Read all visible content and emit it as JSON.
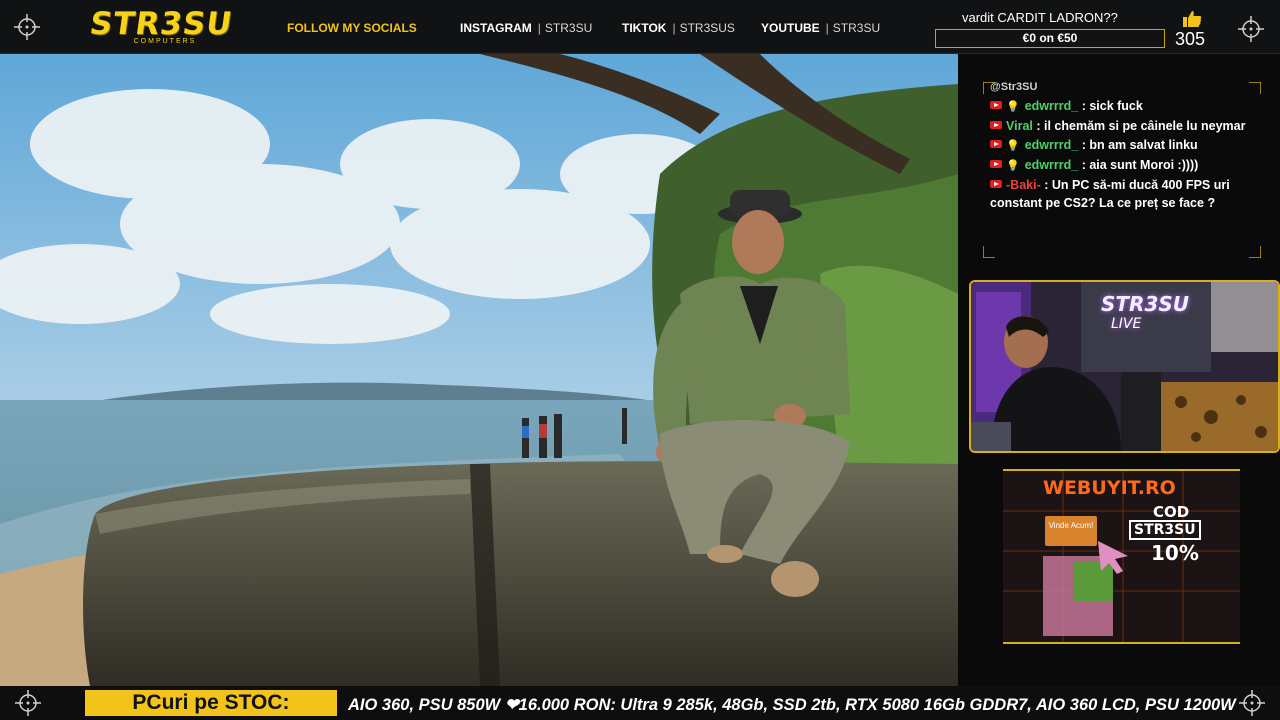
{
  "header": {
    "logo_text": "STR3SU",
    "logo_sub": "COMPUTERS",
    "follow_label": "FOLLOW MY SOCIALS",
    "socials": [
      {
        "platform": "INSTAGRAM",
        "handle": "STR3SU"
      },
      {
        "platform": "TIKTOK",
        "handle": "STR3SUS"
      },
      {
        "platform": "YOUTUBE",
        "handle": "STR3SU"
      }
    ],
    "separator": "|"
  },
  "poll": {
    "title": "vardit CARDIT LADRON??",
    "amount": "€0 on €50"
  },
  "likes": {
    "icon": "thumbs-up-icon",
    "count": "305"
  },
  "chat": {
    "prev_line": "@Str3SU",
    "messages": [
      {
        "user": "edwrrrd_",
        "user_color": "green",
        "badge": "bulb",
        "text": ": sick fuck"
      },
      {
        "user": "Viral",
        "user_color": "green",
        "badge": "",
        "text": ": il chemăm si pe câinele lu neymar"
      },
      {
        "user": "edwrrrd_",
        "user_color": "green",
        "badge": "bulb",
        "text": ": bn am salvat linku"
      },
      {
        "user": "edwrrrd_",
        "user_color": "green",
        "badge": "bulb",
        "text": ": aia sunt Moroi :))))"
      },
      {
        "user": "-Baki-",
        "user_color": "red",
        "badge": "",
        "text": ": Un PC să-mi ducă 400 FPS uri constant pe CS2? La ce preț se face ?"
      }
    ]
  },
  "webcam": {
    "overlay_title": "STR3SU",
    "overlay_live": "LIVE"
  },
  "ad": {
    "brand": "WEBUYIT.RO",
    "cod_label": "COD",
    "code": "STR3SU",
    "discount": "10%",
    "button": "Vinde Acum!"
  },
  "ticker": {
    "label": "PCuri pe STOC:",
    "text": "AIO 360, PSU 850W ❤16.000 RON: Ultra 9 285k, 48Gb, SSD 2tb, RTX 5080 16Gb GDDR7, AIO 360 LCD, PSU 1200W"
  },
  "colors": {
    "accent": "#f2c31a",
    "chat_green": "#50d06a",
    "chat_red": "#ef3f3f",
    "youtube_red": "#e02020"
  }
}
